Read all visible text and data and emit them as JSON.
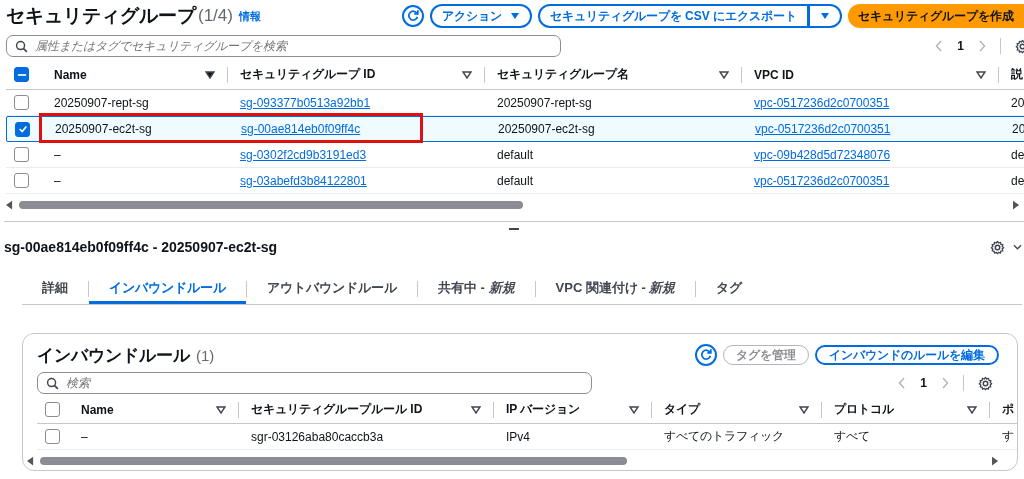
{
  "header": {
    "title": "セキュリティグループ",
    "count": "(1/4)",
    "info_link": "情報",
    "actions": [
      {
        "label": "アクション",
        "kind": "dropdown"
      },
      {
        "label": "セキュリティグループを CSV にエクスポート",
        "kind": "split"
      },
      {
        "label": "セキュリティグループを作成",
        "kind": "primary"
      }
    ]
  },
  "search": {
    "placeholder": "属性またはタグでセキュリティグループを検索"
  },
  "pagination": {
    "page": "1"
  },
  "table": {
    "select_all": {
      "indeterminate": true
    },
    "columns": [
      {
        "label": "Name",
        "sorted": true
      },
      {
        "label": "セキュリティグループ ID",
        "sorted": false
      },
      {
        "label": "セキュリティグループ名",
        "sorted": false
      },
      {
        "label": "VPC ID",
        "sorted": false
      },
      {
        "label": "説"
      }
    ],
    "rows": [
      {
        "selected": false,
        "highlighted": false,
        "name": "20250907-rept-sg",
        "id": "sg-093377b0513a92bb1",
        "group_name": "20250907-rept-sg",
        "vpc": "vpc-0517236d2c0700351",
        "column_5": "20"
      },
      {
        "selected": true,
        "highlighted": true,
        "name": "20250907-ec2t-sg",
        "id": "sg-00ae814eb0f09ff4c",
        "group_name": "20250907-ec2t-sg",
        "vpc": "vpc-0517236d2c0700351",
        "column_5": "20"
      },
      {
        "selected": false,
        "highlighted": false,
        "name": "–",
        "id": "sg-0302f2cd9b3191ed3",
        "group_name": "default",
        "vpc": "vpc-09b428d5d72348076",
        "column_5": "de"
      },
      {
        "selected": false,
        "highlighted": false,
        "name": "–",
        "id": "sg-03abefd3b84122801",
        "group_name": "default",
        "vpc": "vpc-0517236d2c0700351",
        "column_5": "de"
      }
    ]
  },
  "detail": {
    "title": "sg-00ae814eb0f09ff4c - 20250907-ec2t-sg",
    "tabs": [
      {
        "label": "詳細",
        "selected": false
      },
      {
        "label": "インバウンドルール",
        "selected": true
      },
      {
        "label": "アウトバウンドルール",
        "selected": false
      },
      {
        "label": "共有中 - *新規*",
        "selected": false
      },
      {
        "label": "VPC 関連付け - *新規*",
        "selected": false
      },
      {
        "label": "タグ",
        "selected": false
      }
    ],
    "panel": {
      "title": "インバウンドルール",
      "count": "(1)",
      "buttons": [
        {
          "label": "タグを管理",
          "disabled": true
        },
        {
          "label": "インバウンドのルールを編集",
          "disabled": false
        }
      ],
      "search": {
        "placeholder": "検索"
      },
      "pagination": {
        "page": "1"
      },
      "select_all": {
        "checked": false
      },
      "columns": [
        {
          "label": "Name"
        },
        {
          "label": "セキュリティグループルール ID"
        },
        {
          "label": "IP バージョン"
        },
        {
          "label": "タイプ"
        },
        {
          "label": "プロトコル"
        },
        {
          "label": "ポ"
        }
      ],
      "rows": [
        {
          "selected": false,
          "cells": [
            "–",
            "sgr-03126aba80caccb3a",
            "IPv4",
            "すべてのトラフィック",
            "すべて",
            "す"
          ]
        }
      ]
    }
  }
}
